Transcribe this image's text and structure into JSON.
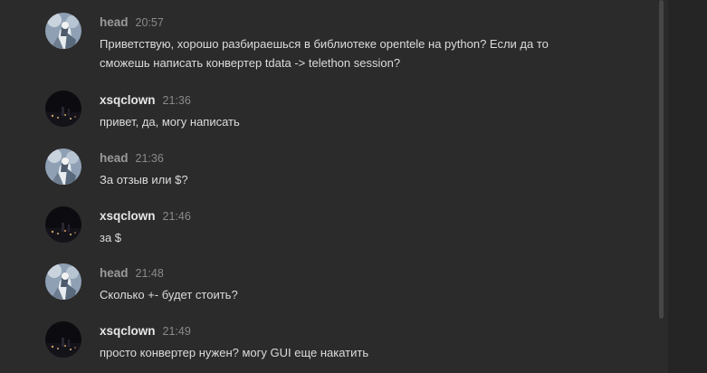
{
  "colors": {
    "background": "#2b2b2b",
    "side_panel": "#252525",
    "author_muted": "#9a9a9a",
    "author_bright": "#e6e6e6",
    "text": "#dcdcdc",
    "timestamp": "#8a8a8a",
    "scroll_thumb": "#464646"
  },
  "messages": [
    {
      "author": "head",
      "time": "20:57",
      "avatar": "anime-character-avatar",
      "text_lines": [
        "Приветствую, хорошо разбираешься в библиотеке opentele на python? Если да то",
        "сможешь написать конвертер tdata -> telethon session?"
      ]
    },
    {
      "author": "xsqclown",
      "time": "21:36",
      "avatar": "night-city-avatar",
      "text_lines": [
        "привет, да, могу написать"
      ]
    },
    {
      "author": "head",
      "time": "21:36",
      "avatar": "anime-character-avatar",
      "text_lines": [
        "За отзыв или $?"
      ]
    },
    {
      "author": "xsqclown",
      "time": "21:46",
      "avatar": "night-city-avatar",
      "text_lines": [
        "за $"
      ]
    },
    {
      "author": "head",
      "time": "21:48",
      "avatar": "anime-character-avatar",
      "text_lines": [
        "Сколько +- будет стоить?"
      ]
    },
    {
      "author": "xsqclown",
      "time": "21:49",
      "avatar": "night-city-avatar",
      "text_lines": [
        "просто конвертер нужен? могу GUI еще накатить"
      ]
    }
  ]
}
